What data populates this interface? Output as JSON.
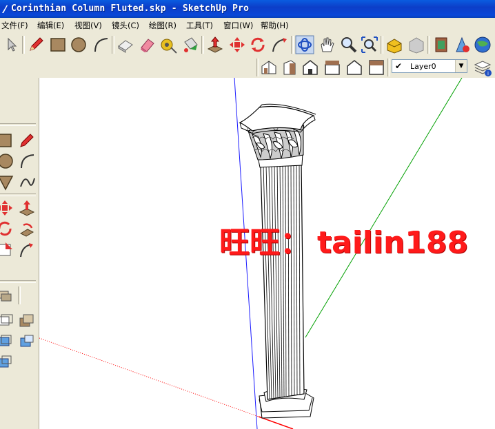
{
  "window": {
    "title": "Corinthian Column Fluted.skp - SketchUp Pro"
  },
  "menu": {
    "items": [
      {
        "label": "文件(F)"
      },
      {
        "label": "编辑(E)"
      },
      {
        "label": "视图(V)"
      },
      {
        "label": "镜头(C)"
      },
      {
        "label": "绘图(R)"
      },
      {
        "label": "工具(T)"
      },
      {
        "label": "窗口(W)"
      },
      {
        "label": "帮助(H)"
      }
    ]
  },
  "layers": {
    "current": "Layer0",
    "checked": true
  },
  "watermark": {
    "prefix": "旺旺：",
    "id": "tailin188"
  },
  "colors": {
    "titlebar": "#0a47d8",
    "watermark": "#ff1a1a",
    "axis_blue": "#1a1aff",
    "axis_green": "#00a000",
    "axis_red": "#ff0000"
  },
  "icons": {
    "toolbar": [
      "select-arrow-icon",
      "pencil-icon",
      "rectangle-icon",
      "circle-icon",
      "arc-icon",
      "make-component-icon",
      "eraser-icon",
      "tape-measure-icon",
      "paint-bucket-icon",
      "push-pull-icon",
      "move-icon",
      "rotate-icon",
      "follow-me-icon",
      "orbit-icon",
      "pan-icon",
      "zoom-icon",
      "zoom-extents-icon",
      "3d-warehouse-icon",
      "share-model-icon",
      "google-earth-icon",
      "get-models-icon",
      "earth-globe-icon"
    ],
    "views": [
      "iso-view-icon",
      "top-view-icon",
      "front-view-icon",
      "right-view-icon",
      "back-view-icon",
      "left-view-icon",
      "layer-manager-icon"
    ]
  }
}
